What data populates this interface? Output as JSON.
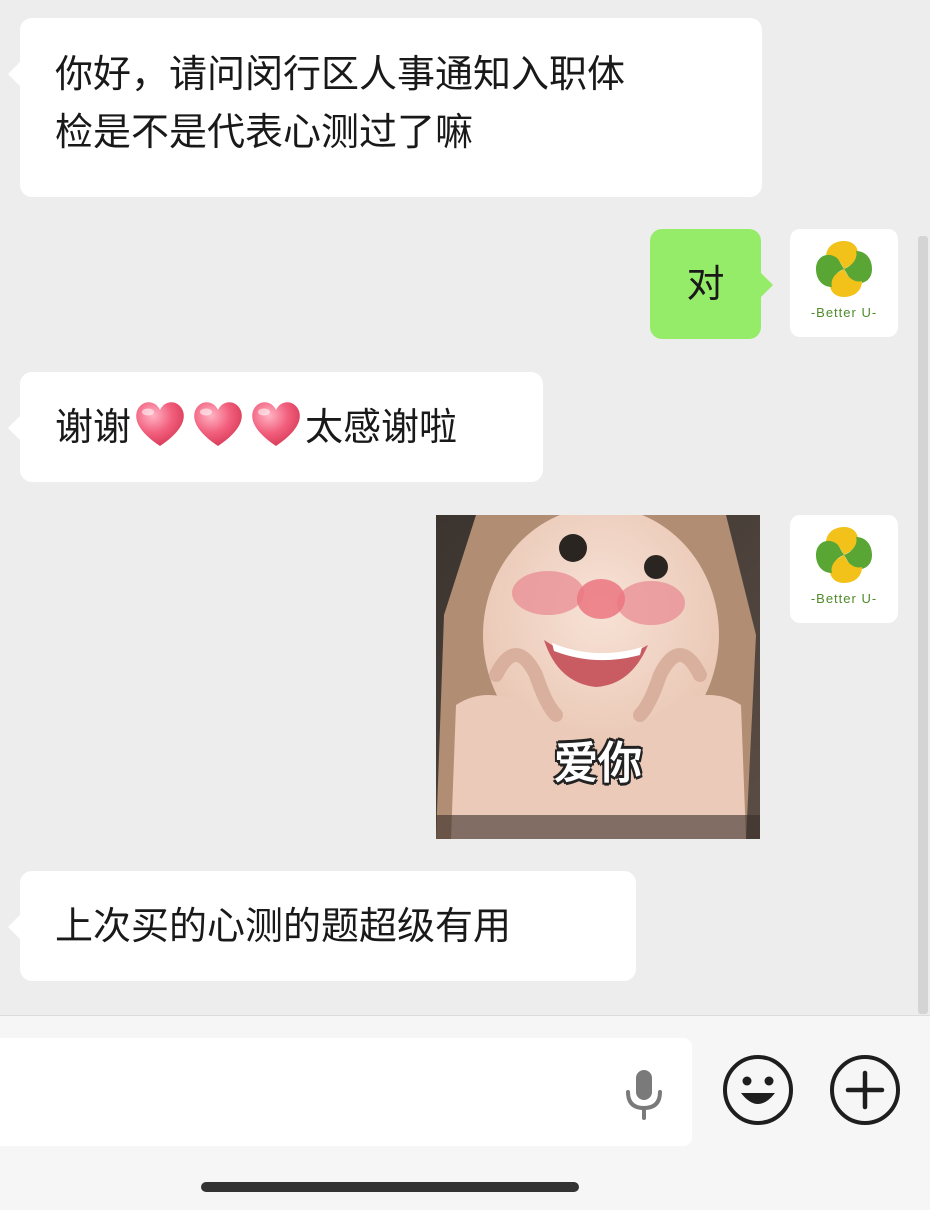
{
  "messages": [
    {
      "side": "in",
      "text_line1": "你好，请问闵行区人事通知入职体",
      "text_line2": "检是不是代表心测过了嘛"
    },
    {
      "side": "out",
      "text": "对"
    },
    {
      "side": "in",
      "text_before": "谢谢",
      "hearts": 3,
      "text_after": "太感谢啦"
    },
    {
      "side": "out",
      "sticker_caption": "爱你"
    },
    {
      "side": "in",
      "text": "上次买的心测的题超级有用"
    }
  ],
  "avatar": {
    "brand_text": "-Better U-",
    "colors": {
      "yellow": "#f2c21b",
      "green": "#5aa634"
    }
  },
  "input_bar": {
    "message_value": "",
    "icons": [
      "microphone-icon",
      "emoji-icon",
      "plus-icon"
    ]
  },
  "colors": {
    "background": "#ededed",
    "incoming_bubble": "#ffffff",
    "outgoing_bubble": "#95ec69"
  }
}
